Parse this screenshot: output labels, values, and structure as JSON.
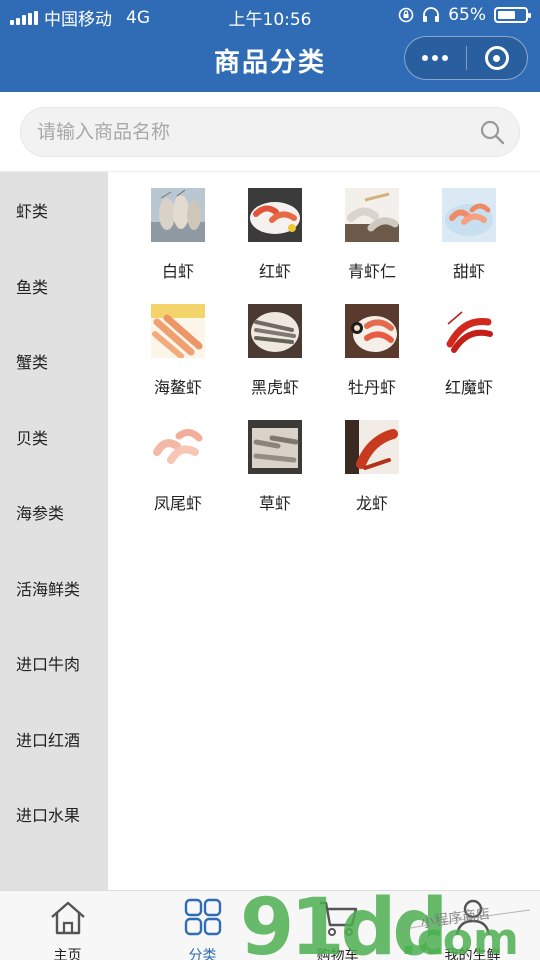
{
  "status_bar": {
    "carrier": "中国移动",
    "network": "4G",
    "time": "上午10:56",
    "battery": "65%",
    "battery_level": 0.65
  },
  "header": {
    "title": "商品分类"
  },
  "search": {
    "placeholder": "请输入商品名称",
    "value": ""
  },
  "sidebar": {
    "items": [
      {
        "label": "虾类",
        "active": true
      },
      {
        "label": "鱼类"
      },
      {
        "label": "蟹类"
      },
      {
        "label": "贝类"
      },
      {
        "label": "海参类"
      },
      {
        "label": "活海鲜类"
      },
      {
        "label": "进口牛肉"
      },
      {
        "label": "进口红酒"
      },
      {
        "label": "进口水果"
      }
    ]
  },
  "products": [
    {
      "name": "白虾"
    },
    {
      "name": "红虾"
    },
    {
      "name": "青虾仁"
    },
    {
      "name": "甜虾"
    },
    {
      "name": "海鳌虾"
    },
    {
      "name": "黑虎虾"
    },
    {
      "name": "牡丹虾"
    },
    {
      "name": "红魔虾"
    },
    {
      "name": "凤尾虾"
    },
    {
      "name": "草虾"
    },
    {
      "name": "龙虾"
    }
  ],
  "tabbar": {
    "items": [
      {
        "label": "主页",
        "icon": "home-icon"
      },
      {
        "label": "分类",
        "icon": "grid-icon",
        "active": true
      },
      {
        "label": "购物车",
        "icon": "cart-icon"
      },
      {
        "label": "我的生鲜",
        "icon": "user-icon"
      }
    ]
  },
  "watermark": {
    "text": "91dd.com",
    "tagline": "小程序商店"
  },
  "colors": {
    "brand": "#2f6cb5",
    "sidebar_bg": "#e1e1e1",
    "watermark": "#4caf50"
  }
}
